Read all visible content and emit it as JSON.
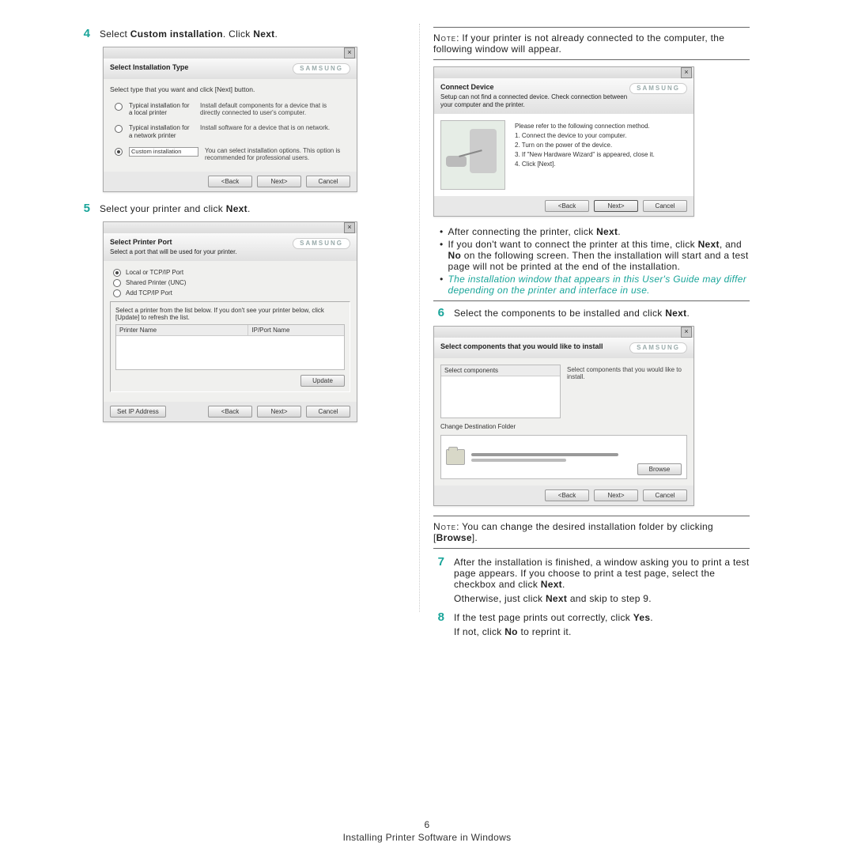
{
  "steps": {
    "s4": "Select Custom installation. Click Next.",
    "s5": "Select your printer and click Next.",
    "s6": "Select the components to be installed and click Next.",
    "s7": "After the installation is finished, a window asking you to print a test page appears. If you choose to print a test page, select the checkbox and click Next.",
    "s7b": "Otherwise, just click Next and skip to step 9.",
    "s8": "If the test page prints out correctly, click Yes.",
    "s8b": "If not, click No to reprint it."
  },
  "bold": {
    "custom": "Custom installation",
    "next": "Next",
    "yes": "Yes",
    "no": "No",
    "browse": "Browse"
  },
  "notes": {
    "note_label": "Note",
    "n1": ": If your printer is not already connected to the computer, the following window will appear.",
    "n2": ": You can change the desired installation folder by clicking ["
  },
  "bullets": {
    "b1": "After connecting the printer, click Next.",
    "b2": "If you don't want to connect the printer at this time, click Next, and No on the following screen. Then the installation will start and a test page will not be printed at the end of the installation.",
    "b3": "The installation window that appears in this User's Guide may differ depending on the printer and interface in use."
  },
  "brand": "SAMSUNG",
  "dlg1": {
    "title": "Select Installation Type",
    "intro": "Select type that you want and click [Next] button.",
    "opt1_label": "Typical installation for a local printer",
    "opt1_desc": "Install default components for a device that is directly connected to user's computer.",
    "opt2_label": "Typical installation for a network printer",
    "opt2_desc": "Install software for a device that is on network.",
    "opt3_label": "Custom installation",
    "opt3_desc": "You can select installation options. This option is recommended for professional users.",
    "back": "<Back",
    "next": "Next>",
    "cancel": "Cancel"
  },
  "dlg2": {
    "title": "Select Printer Port",
    "sub": "Select a port that will be used for your printer.",
    "opt1": "Local or TCP/IP Port",
    "opt2": "Shared Printer (UNC)",
    "opt3": "Add TCP/IP Port",
    "list_intro": "Select a printer from the list below. If you don't see your printer below, click [Update] to refresh the list.",
    "col1": "Printer Name",
    "col2": "IP/Port Name",
    "update": "Update",
    "setip": "Set IP Address",
    "back": "<Back",
    "next": "Next>",
    "cancel": "Cancel"
  },
  "dlg3": {
    "title": "Connect Device",
    "sub": "Setup can not find a connected device. Check connection between your computer and the printer.",
    "intro": "Please refer to the following connection method.",
    "s1": "1. Connect the device to your computer.",
    "s2": "2. Turn on the power of the device.",
    "s3": "3. If \"New Hardware Wizard\" is appeared, close it.",
    "s4": "4. Click [Next].",
    "back": "<Back",
    "next": "Next>",
    "cancel": "Cancel"
  },
  "dlg4": {
    "title": "Select components that you would like to install",
    "list_hdr": "Select components",
    "desc": "Select components that you would like to install.",
    "dest_hdr": "Change Destination Folder",
    "browse": "Browse",
    "back": "<Back",
    "next": "Next>",
    "cancel": "Cancel"
  },
  "footer": {
    "page": "6",
    "section": "Installing Printer Software in Windows"
  }
}
